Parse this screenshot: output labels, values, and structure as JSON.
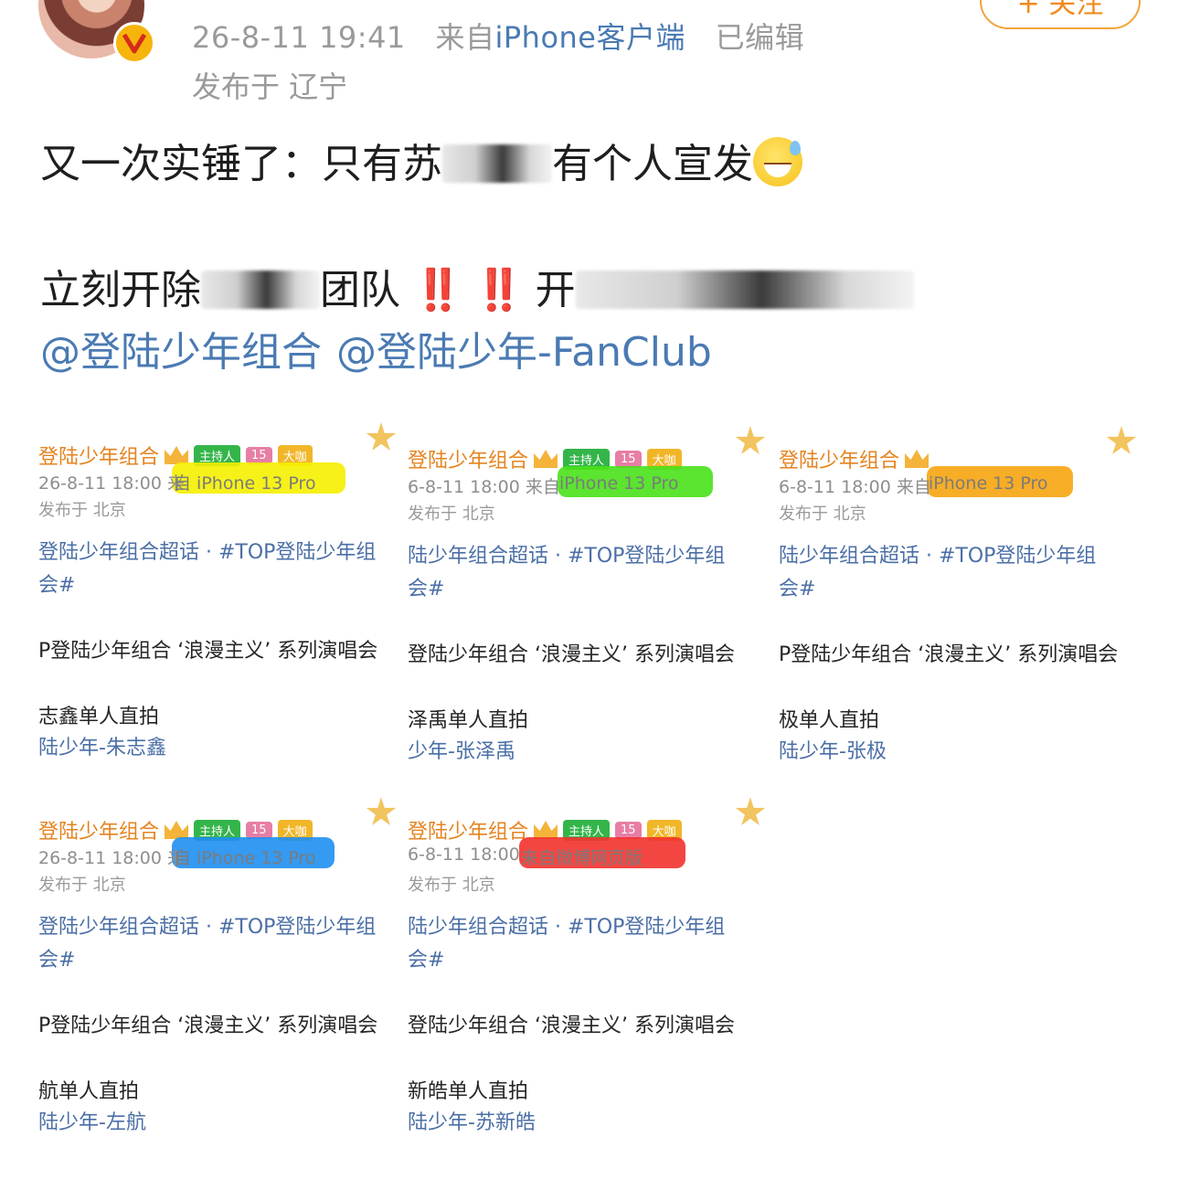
{
  "header": {
    "timestamp": "26-8-11 19:41",
    "source_prefix": "来自",
    "source_device": "iPhone客户端",
    "edited": "已编辑",
    "location": "发布于 辽宁",
    "follow_label": "+ 关注",
    "verified_icon": "v-badge-icon"
  },
  "post": {
    "line1_a": "又一次实锤了：只有苏",
    "line1_b": "有个人宣发",
    "line2_a": "立刻开除",
    "line2_b": "团队",
    "line2_c": "开",
    "bang": "‼️",
    "mentions": [
      "@登陆少年组合",
      "@登陆少年-FanClub"
    ]
  },
  "tiles": [
    {
      "name": "登陆少年组合",
      "time": "26-8-11 18:00  来",
      "from": "自 iPhone 13 Pro",
      "highlight": "#f5f000",
      "location": "发布于 北京",
      "topic": "登陆少年组合超话 · #TOP登陆少年组",
      "topic2": "会#",
      "concert": "P登陆少年组合 ‘浪漫主义’ 系列演唱会",
      "solo": "志鑫单人直拍",
      "link": "陆少年-朱志鑫",
      "chips": [
        "主持人",
        "15",
        "大咖"
      ]
    },
    {
      "name": "登陆少年组合",
      "time": "6-8-11 18:00  来自",
      "from": "iPhone 13 Pro",
      "highlight": "#49e11a",
      "location": "发布于 北京",
      "topic": "陆少年组合超话 · #TOP登陆少年组",
      "topic2": "会#",
      "concert": "登陆少年组合 ‘浪漫主义’ 系列演唱会",
      "solo": "泽禹单人直拍",
      "link": "少年-张泽禹",
      "chips": [
        "主持人",
        "15",
        "大咖"
      ]
    },
    {
      "name": "登陆少年组合",
      "time": "6-8-11 18:00  来自",
      "from": "iPhone 13 Pro",
      "highlight": "#f7a40e",
      "location": "发布于 北京",
      "topic": "陆少年组合超话 · #TOP登陆少年组",
      "topic2": "会#",
      "concert": "P登陆少年组合 ‘浪漫主义’ 系列演唱会",
      "solo": "极单人直拍",
      "link": "陆少年-张极",
      "chips": []
    },
    {
      "name": "登陆少年组合",
      "time": "26-8-11 18:00  来",
      "from": "自 iPhone 13 Pro",
      "highlight": "#1f8ff0",
      "location": "发布于 北京",
      "topic": "登陆少年组合超话 · #TOP登陆少年组",
      "topic2": "会#",
      "concert": "P登陆少年组合 ‘浪漫主义’ 系列演唱会",
      "solo": "航单人直拍",
      "link": "陆少年-左航",
      "chips": [
        "主持人",
        "15",
        "大咖"
      ]
    },
    {
      "name": "登陆少年组合",
      "time": "6-8-11 18:00",
      "from": "来自微博网页版",
      "highlight": "#f2322e",
      "location": "发布于 北京",
      "topic": "陆少年组合超话 · #TOP登陆少年组",
      "topic2": "会#",
      "concert": "登陆少年组合 ‘浪漫主义’ 系列演唱会",
      "solo": "新皓单人直拍",
      "link": "陆少年-苏新皓",
      "chips": [
        "主持人",
        "15",
        "大咖"
      ]
    }
  ],
  "colors": {
    "link_blue": "#4a7ab3",
    "meta_gray": "#9a9a9a",
    "follow_orange": "#f28a1a",
    "alert_red": "#e2141b"
  }
}
